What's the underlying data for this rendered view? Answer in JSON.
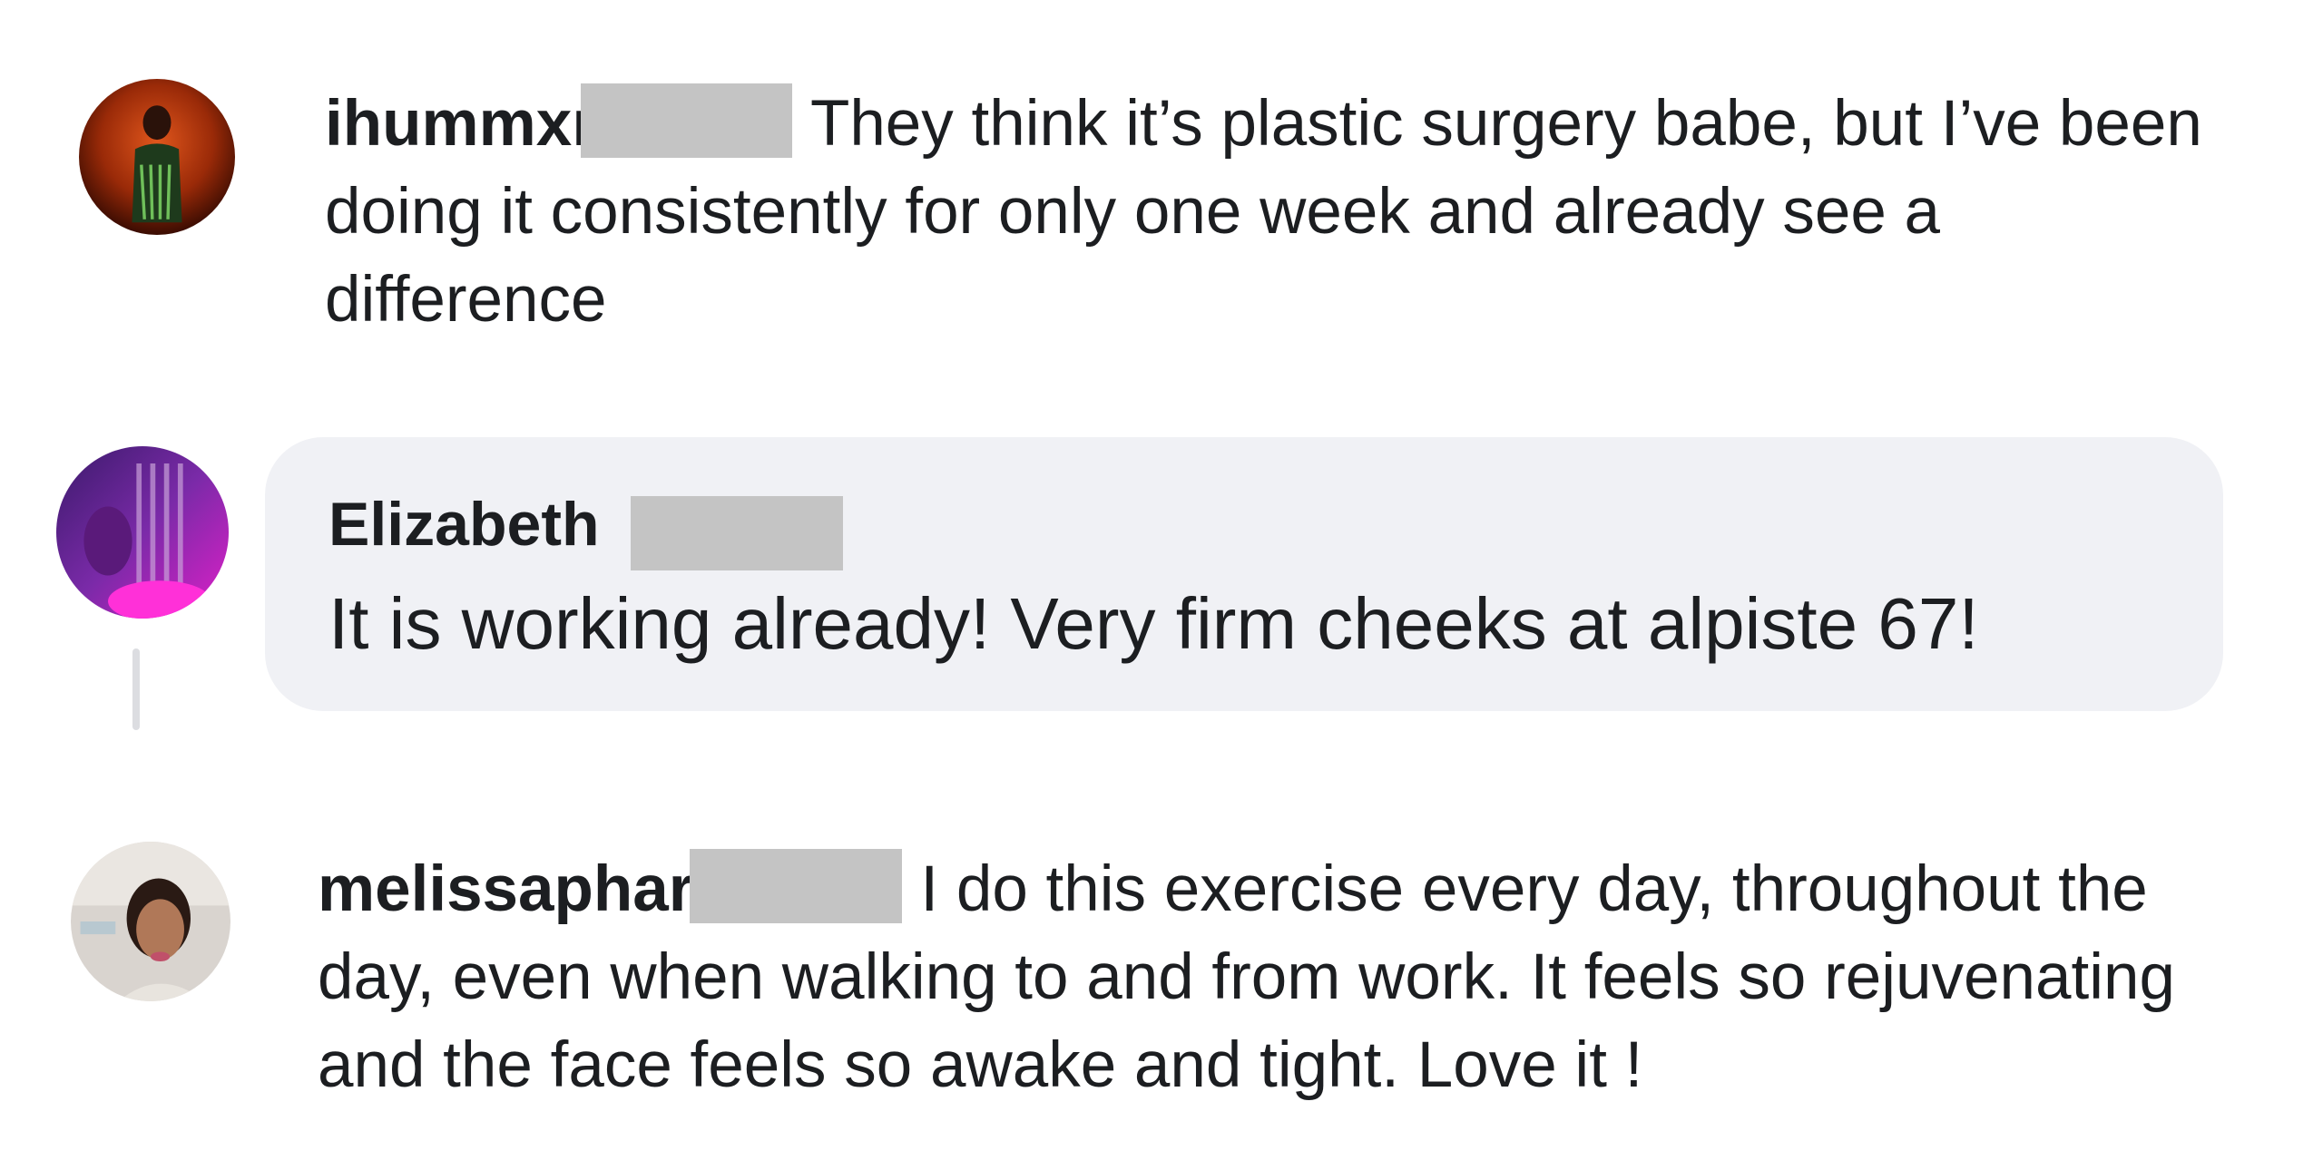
{
  "comments": [
    {
      "username": "ihummxı",
      "text": "They think it’s plastic surgery babe, but I’ve been doing it consistently for only one week and already see a difference",
      "avatar_icon": "profile-photo-avatar"
    },
    {
      "username": "Elizabeth",
      "text": "It is working already! Very firm cheeks at alpiste 67!",
      "avatar_icon": "profile-photo-avatar"
    },
    {
      "username": "melissaphar",
      "text": "I do this exercise every day, throughout the day, even when walking to and from work. It feels so rejuvenating and the face feels so awake and tight. Love it !",
      "avatar_icon": "profile-photo-avatar"
    }
  ],
  "colors": {
    "bubble_bg": "#f0f1f5",
    "redaction": "#c4c4c4",
    "thread_line": "#dcdde1",
    "text": "#1c1e21"
  }
}
